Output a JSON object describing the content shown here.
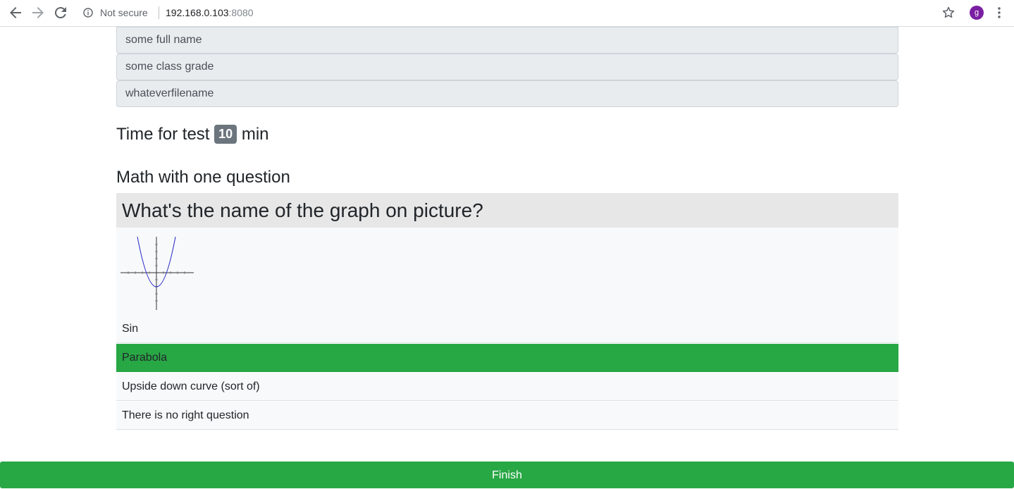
{
  "browser": {
    "security_label": "Not secure",
    "url_host": "192.168.0.103",
    "url_port": ":8080",
    "avatar_letter": "g"
  },
  "form": {
    "full_name": "some full name",
    "class_grade": "some class grade",
    "filename": "whateverfilename"
  },
  "test": {
    "time_label": "Time for test",
    "time_value": "10",
    "time_unit": "min",
    "title": "Math with one question",
    "question": "What's the name of the graph on picture?",
    "answers": [
      {
        "label": "Sin",
        "selected": false
      },
      {
        "label": "Parabola",
        "selected": true
      },
      {
        "label": "Upside down curve (sort of)",
        "selected": false
      },
      {
        "label": "There is no right question",
        "selected": false
      }
    ]
  },
  "finish_label": "Finish",
  "icons": [
    "back-icon",
    "forward-icon",
    "reload-icon",
    "info-icon",
    "star-icon",
    "menu-icon"
  ],
  "colors": {
    "selected_answer": "#28a745",
    "finish_button": "#28a745",
    "badge": "#6c757d",
    "graph_curve": "#2222cc"
  }
}
